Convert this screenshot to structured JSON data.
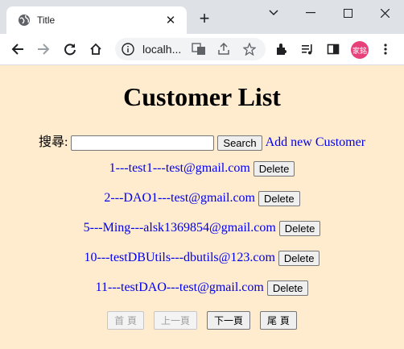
{
  "browser": {
    "tab_title": "Title",
    "url": "localh...",
    "avatar_text": "家銘"
  },
  "page": {
    "heading": "Customer List",
    "search_label": "搜尋:",
    "search_value": "",
    "search_button": "Search",
    "add_link": "Add new Customer",
    "customers": [
      {
        "text": "1---test1---test@gmail.com",
        "delete_label": "Delete"
      },
      {
        "text": "2---DAO1---test@gmail.com",
        "delete_label": "Delete"
      },
      {
        "text": "5---Ming---alsk1369854@gmail.com",
        "delete_label": "Delete"
      },
      {
        "text": "10---testDBUtils---dbutils@123.com",
        "delete_label": "Delete"
      },
      {
        "text": "11---testDAO---test@gmail.com",
        "delete_label": "Delete"
      }
    ],
    "pager": {
      "first": "首 頁",
      "prev": "上一頁",
      "next": "下一頁",
      "last": "尾 頁"
    }
  },
  "colors": {
    "page_background": "#ffebcd",
    "link": "#0000ee"
  }
}
